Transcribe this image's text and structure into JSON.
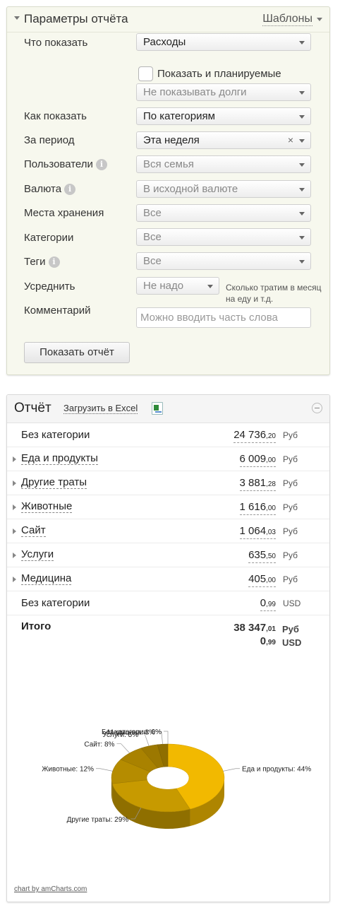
{
  "params": {
    "title": "Параметры отчёта",
    "templates_label": "Шаблоны",
    "rows": {
      "what": {
        "label": "Что показать",
        "value": "Расходы"
      },
      "planned_checkbox": {
        "label": "Показать и планируемые",
        "checked": false
      },
      "debts": {
        "value": "Не показывать долги"
      },
      "how": {
        "label": "Как показать",
        "value": "По категориям"
      },
      "period": {
        "label": "За период",
        "value": "Эта неделя",
        "clear": "×"
      },
      "users": {
        "label": "Пользователи",
        "value": "Вся семья"
      },
      "currency": {
        "label": "Валюта",
        "value": "В исходной валюте"
      },
      "storage": {
        "label": "Места хранения",
        "value": "Все"
      },
      "categories": {
        "label": "Категории",
        "value": "Все"
      },
      "tags": {
        "label": "Теги",
        "value": "Все"
      },
      "average": {
        "label": "Усреднить",
        "value": "Не надо",
        "hint": "Сколько тратим в месяц на еду и т.д."
      },
      "comment": {
        "label": "Комментарий",
        "placeholder": "Можно вводить часть слова"
      }
    },
    "info_glyph": "i",
    "show_button": "Показать отчёт"
  },
  "report": {
    "title": "Отчёт",
    "excel_link": "Загрузить в Excel",
    "rows": [
      {
        "name": "Без категории",
        "int": "24 736",
        "dec": ",20",
        "currency": "Руб",
        "expandable": false
      },
      {
        "name": "Еда и продукты",
        "int": "6 009",
        "dec": ",00",
        "currency": "Руб",
        "expandable": true
      },
      {
        "name": "Другие траты",
        "int": "3 881",
        "dec": ",28",
        "currency": "Руб",
        "expandable": true
      },
      {
        "name": "Животные",
        "int": "1 616",
        "dec": ",00",
        "currency": "Руб",
        "expandable": true
      },
      {
        "name": "Сайт",
        "int": "1 064",
        "dec": ",03",
        "currency": "Руб",
        "expandable": true
      },
      {
        "name": "Услуги",
        "int": "635",
        "dec": ",50",
        "currency": "Руб",
        "expandable": true
      },
      {
        "name": "Медицина",
        "int": "405",
        "dec": ",00",
        "currency": "Руб",
        "expandable": true
      },
      {
        "name": "Без категории",
        "int": "0",
        "dec": ",99",
        "currency": "USD",
        "expandable": false
      }
    ],
    "total": {
      "label": "Итого",
      "lines": [
        {
          "int": "38 347",
          "dec": ",01",
          "currency": "Руб"
        },
        {
          "int": "0",
          "dec": ",99",
          "currency": "USD"
        }
      ]
    },
    "credit": "chart by amCharts.com"
  },
  "chart_data": {
    "type": "pie",
    "style": "3d-donut",
    "slices": [
      {
        "label": "Еда и продукты",
        "value": 44,
        "color": "#f2b900"
      },
      {
        "label": "Другие траты",
        "value": 29,
        "color": "#c79a00"
      },
      {
        "label": "Животные",
        "value": 12,
        "color": "#b58c00"
      },
      {
        "label": "Сайт",
        "value": 8,
        "color": "#a98200"
      },
      {
        "label": "Услуги",
        "value": 5,
        "color": "#9c7800"
      },
      {
        "label": "Медицина",
        "value": 3,
        "color": "#8f6e00"
      },
      {
        "label": "Без категории",
        "value": 0,
        "color": "#806200"
      }
    ],
    "label_suffix": "%"
  }
}
